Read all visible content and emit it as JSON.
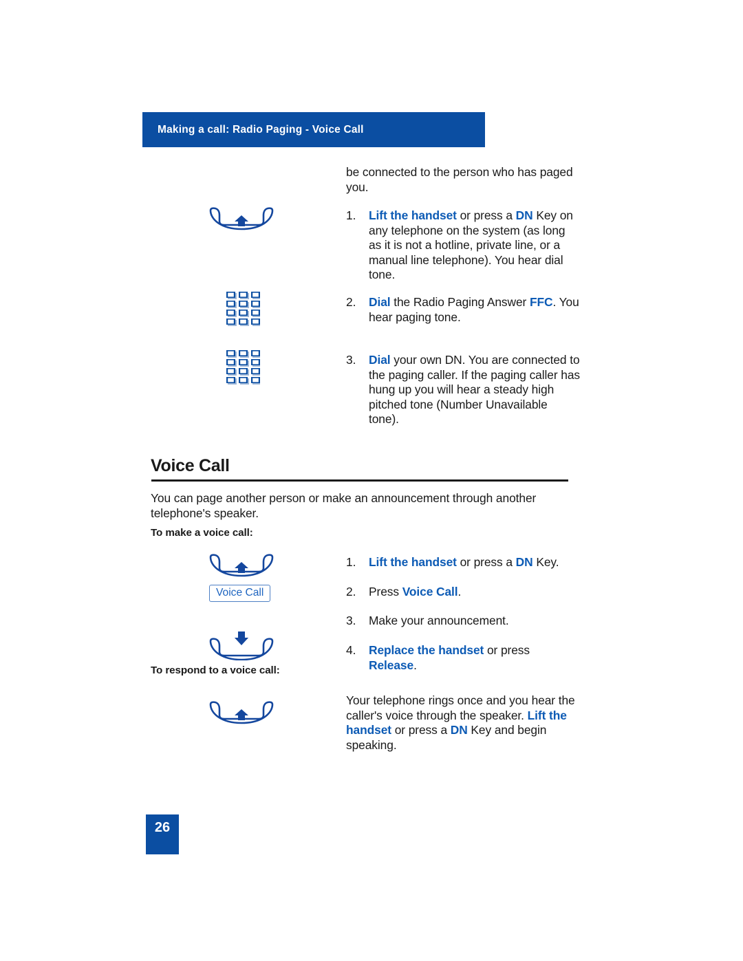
{
  "header": {
    "breadcrumb": "Making a call: Radio Paging - Voice Call"
  },
  "top_section": {
    "intro_lead": "be connected to the person who has paged",
    "intro_rest": "you.",
    "steps": [
      {
        "number": "1.",
        "parts": [
          {
            "text": "Lift the handset",
            "style": "highlight"
          },
          {
            "text": " or press a ",
            "style": "plain"
          },
          {
            "text": "DN",
            "style": "highlight"
          },
          {
            "text": " Key on any telephone on the system (as long as it is not a hotline, private line, or a manual line telephone). You hear dial tone.",
            "style": "plain"
          }
        ],
        "icon": "lift-handset-icon"
      },
      {
        "number": "2.",
        "parts": [
          {
            "text": "Dial",
            "style": "highlight"
          },
          {
            "text": " the Radio Paging Answer ",
            "style": "plain"
          },
          {
            "text": "FFC",
            "style": "highlight"
          },
          {
            "text": ". You hear paging tone.",
            "style": "plain"
          }
        ],
        "icon": "dial-keypad-icon"
      },
      {
        "number": "3.",
        "parts": [
          {
            "text": "Dial",
            "style": "highlight"
          },
          {
            "text": " your own DN. You are connected to the paging caller. If the paging caller has hung up you will hear a steady high pitched tone (Number Unavailable tone).",
            "style": "plain"
          }
        ],
        "icon": "dial-keypad-icon"
      }
    ]
  },
  "voice_call_section": {
    "heading": "Voice Call",
    "description": "You can page another person or make an announcement through another telephone's speaker.",
    "make_label": "To make a voice call:",
    "respond_label": "To respond to a voice call:",
    "key_button_label": "Voice Call",
    "make_steps": [
      {
        "number": "1.",
        "parts": [
          {
            "text": "Lift the handset",
            "style": "highlight"
          },
          {
            "text": " or press a ",
            "style": "plain"
          },
          {
            "text": "DN",
            "style": "highlight"
          },
          {
            "text": " Key.",
            "style": "plain"
          }
        ],
        "icon": "lift-handset-icon"
      },
      {
        "number": "2.",
        "parts": [
          {
            "text": "Press ",
            "style": "plain"
          },
          {
            "text": "Voice Call",
            "style": "highlight"
          },
          {
            "text": ".",
            "style": "plain"
          }
        ],
        "icon": "voice-call-key-icon"
      },
      {
        "number": "3.",
        "parts": [
          {
            "text": "Make your announcement.",
            "style": "plain"
          }
        ],
        "icon": ""
      },
      {
        "number": "4.",
        "parts": [
          {
            "text": "Replace the handset",
            "style": "highlight"
          },
          {
            "text": " or press ",
            "style": "plain"
          },
          {
            "text": "Release",
            "style": "highlight"
          },
          {
            "text": ".",
            "style": "plain"
          }
        ],
        "icon": "replace-handset-icon"
      }
    ],
    "respond_paragraph": [
      {
        "text": "Your telephone rings once and you hear the caller's voice through the speaker. ",
        "style": "plain"
      },
      {
        "text": "Lift the handset",
        "style": "highlight"
      },
      {
        "text": " or press a ",
        "style": "plain"
      },
      {
        "text": "DN",
        "style": "highlight"
      },
      {
        "text": " Key and begin speaking.",
        "style": "plain"
      }
    ]
  },
  "footer": {
    "page_number": "26"
  },
  "colors": {
    "brand_blue": "#0b4ea2",
    "highlight_blue": "#0d5bb5",
    "icon_blue": "#14479e",
    "key_border": "#4d7fc4",
    "text_black": "#1a1a1a"
  }
}
